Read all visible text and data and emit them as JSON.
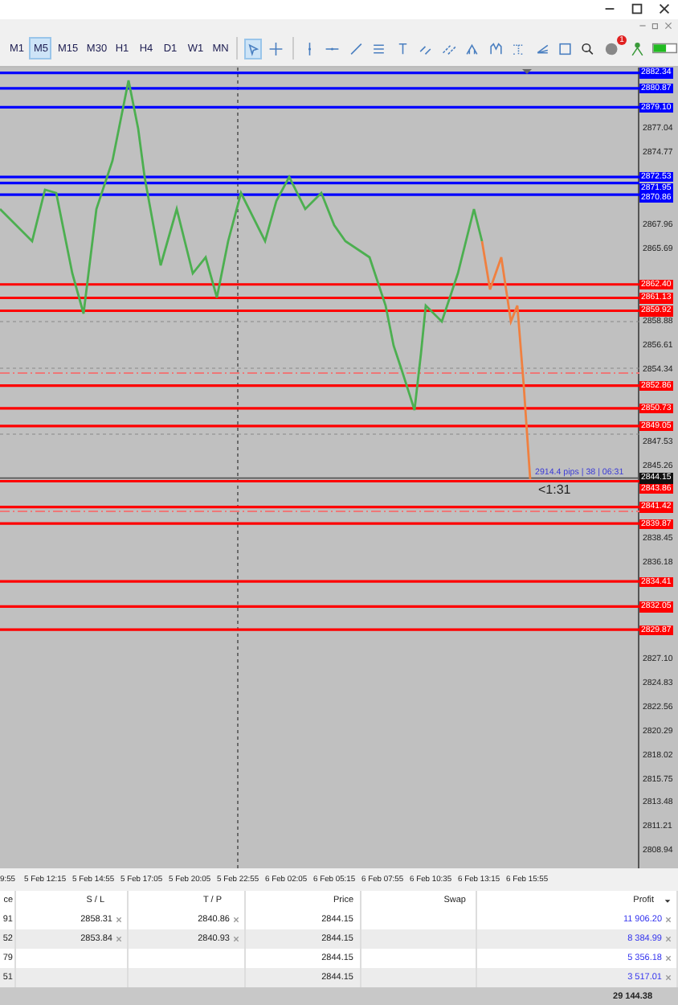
{
  "toolbar": {
    "timeframes": [
      {
        "label": "M1",
        "selected": false
      },
      {
        "label": "M5",
        "selected": true
      },
      {
        "label": "M15",
        "selected": false
      },
      {
        "label": "M30",
        "selected": false
      },
      {
        "label": "H1",
        "selected": false
      },
      {
        "label": "H4",
        "selected": false
      },
      {
        "label": "D1",
        "selected": false
      },
      {
        "label": "W1",
        "selected": false
      },
      {
        "label": "MN",
        "selected": false
      }
    ],
    "notification_badge": "1"
  },
  "chart": {
    "levels": [
      {
        "label": "2882.34",
        "color": "#0000ff"
      },
      {
        "label": "2880.87",
        "color": "#0000ff"
      },
      {
        "label": "2879.10",
        "color": "#0000ff"
      },
      {
        "label": "2872.53",
        "color": "#0000ff"
      },
      {
        "label": "2871.95",
        "color": "#0000ff"
      },
      {
        "label": "2870.86",
        "color": "#0000ff"
      },
      {
        "label": "2862.40",
        "color": "#ff0000"
      },
      {
        "label": "2861.13",
        "color": "#ff0000"
      },
      {
        "label": "2859.92",
        "color": "#ff0000"
      },
      {
        "label": "2852.86",
        "color": "#ff0000"
      },
      {
        "label": "2850.73",
        "color": "#ff0000"
      },
      {
        "label": "2849.05",
        "color": "#ff0000"
      },
      {
        "label": "2843.86",
        "color": "#ff0000"
      },
      {
        "label": "2841.42",
        "color": "#ff0000"
      },
      {
        "label": "2839.87",
        "color": "#ff0000"
      },
      {
        "label": "2834.41",
        "color": "#ff0000"
      },
      {
        "label": "2832.05",
        "color": "#ff0000"
      },
      {
        "label": "2829.87",
        "color": "#ff0000"
      }
    ],
    "current_price": "2844.15",
    "trade_info": "2914.4 pips | 38 | 06:31",
    "countdown": "<1:31",
    "price_ticks": [
      "2877.04",
      "2874.77",
      "2867.96",
      "2865.69",
      "2858.88",
      "2856.61",
      "2854.34",
      "2847.53",
      "2845.26",
      "2838.45",
      "2836.18",
      "2827.10",
      "2824.83",
      "2822.56",
      "2820.29",
      "2818.02",
      "2815.75",
      "2813.48",
      "2811.21",
      "2808.94"
    ],
    "time_ticks": [
      "9:55",
      "5 Feb 12:15",
      "5 Feb 14:55",
      "5 Feb 17:05",
      "5 Feb 20:05",
      "5 Feb 22:55",
      "6 Feb 02:05",
      "6 Feb 05:15",
      "6 Feb 07:55",
      "6 Feb 10:35",
      "6 Feb 13:15",
      "6 Feb 15:55"
    ]
  },
  "table": {
    "columns": [
      "ce",
      "S / L",
      "T / P",
      "Price",
      "Swap",
      "Profit"
    ],
    "rows": [
      {
        "ticket": "91",
        "sl": "2858.31",
        "tp": "2840.86",
        "price": "2844.15",
        "profit": "11 906.20"
      },
      {
        "ticket": "52",
        "sl": "2853.84",
        "tp": "2840.93",
        "price": "2844.15",
        "profit": "8 384.99"
      },
      {
        "ticket": "79",
        "price": "2844.15",
        "profit": "5 356.18"
      },
      {
        "ticket": "51",
        "price": "2844.15",
        "profit": "3 517.01"
      }
    ],
    "total": "29 144.38"
  }
}
